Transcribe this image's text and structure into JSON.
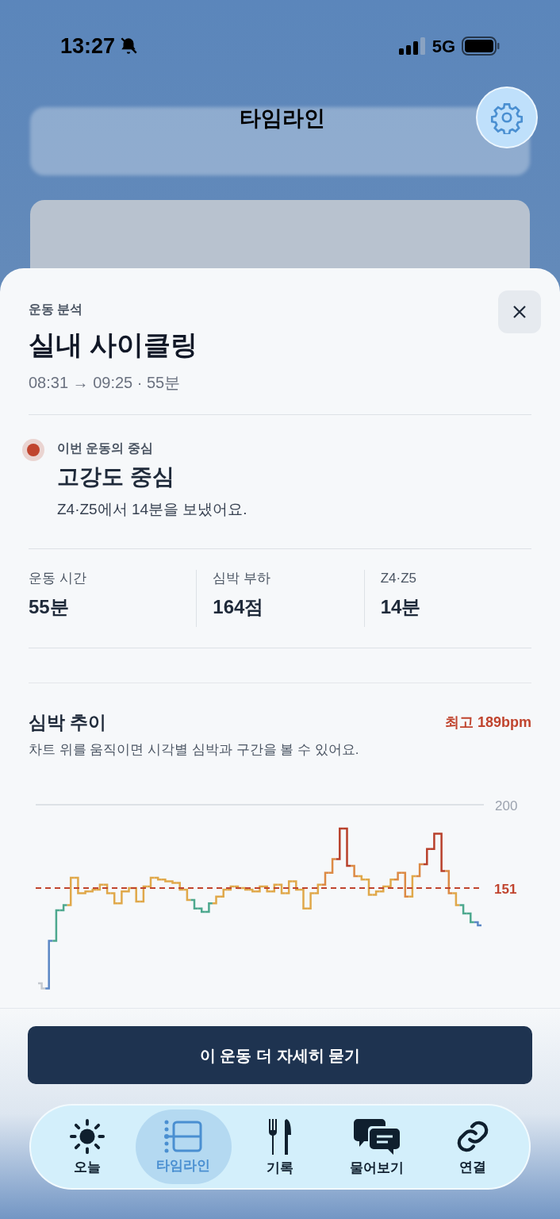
{
  "status_bar": {
    "time": "13:27",
    "muted": true,
    "network": "5G"
  },
  "header": {
    "title": "타임라인"
  },
  "sheet": {
    "eyebrow": "운동 분석",
    "title": "실내 사이클링",
    "time_range": "08:31 → 09:25 · 55분",
    "focus": {
      "label": "이번 운동의 중심",
      "title": "고강도 중심",
      "description": "Z4·Z5에서 14분을 보냈어요.",
      "color": "#c0442e"
    },
    "stats": [
      {
        "label": "운동 시간",
        "value": "55분"
      },
      {
        "label": "심박 부하",
        "value": "164점"
      },
      {
        "label": "Z4·Z5",
        "value": "14분"
      }
    ],
    "heart_rate": {
      "title": "심박 추이",
      "max_label": "최고 189bpm",
      "caption": "차트 위를 움직이면 시각별 심박과 구간을 볼 수 있어요.",
      "top_label": "200",
      "threshold_label": "151"
    }
  },
  "cta": {
    "label": "이 운동 더 자세히 묻기"
  },
  "tab_bar": [
    {
      "label": "오늘",
      "kind": "sun",
      "selected": false
    },
    {
      "label": "타임라인",
      "kind": "timeline",
      "selected": true
    },
    {
      "label": "기록",
      "kind": "meal",
      "selected": false
    },
    {
      "label": "물어보기",
      "kind": "chat",
      "selected": false
    },
    {
      "label": "연결",
      "kind": "link",
      "selected": false
    }
  ]
}
